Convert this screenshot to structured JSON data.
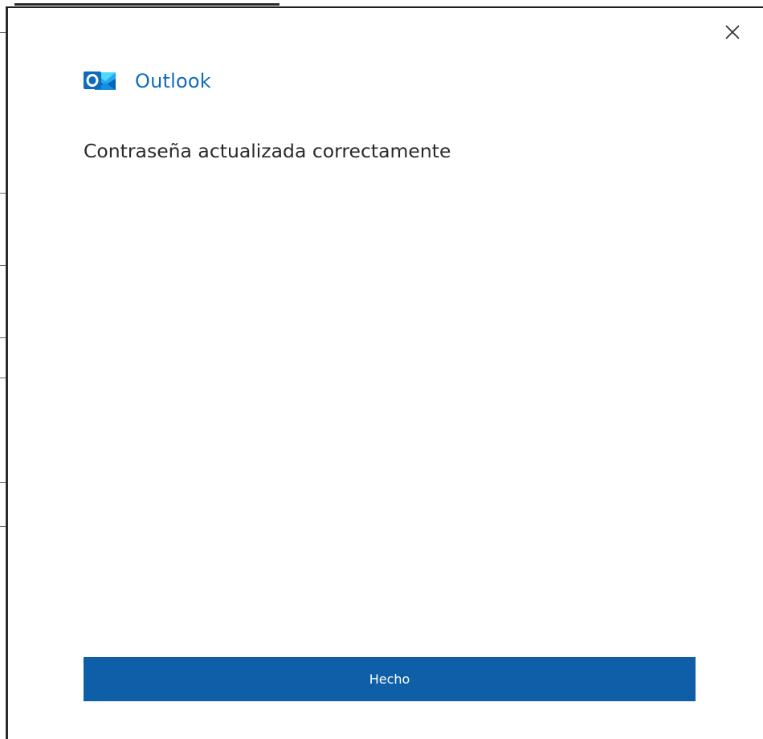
{
  "app": {
    "name": "Outlook",
    "logo_icon": "outlook-logo-icon",
    "accent_color": "#0f6cbd"
  },
  "dialog": {
    "message": "Contraseña actualizada correctamente",
    "done_button_label": "Hecho",
    "close_icon": "close-icon",
    "button_color": "#0f5fa8"
  }
}
